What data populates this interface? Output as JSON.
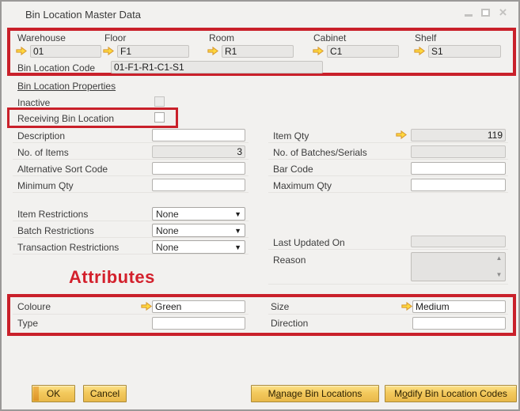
{
  "window": {
    "title": "Bin Location Master Data"
  },
  "location": {
    "segments": [
      {
        "label": "Warehouse",
        "value": "01"
      },
      {
        "label": "Floor",
        "value": "F1"
      },
      {
        "label": "Room",
        "value": "R1"
      },
      {
        "label": "Cabinet",
        "value": "C1"
      },
      {
        "label": "Shelf",
        "value": "S1"
      }
    ],
    "bin_location_code": {
      "label": "Bin Location Code",
      "value": "01-F1-R1-C1-S1"
    }
  },
  "links": {
    "bin_location_properties": "Bin Location Properties"
  },
  "checkboxes": {
    "inactive": {
      "label": "Inactive"
    },
    "receiving": {
      "label": "Receiving Bin Location"
    }
  },
  "fields_left": [
    {
      "label": "Description",
      "value": ""
    },
    {
      "label": "No. of Items",
      "value": "3"
    },
    {
      "label": "Alternative Sort Code",
      "value": ""
    },
    {
      "label": "Minimum Qty",
      "value": ""
    }
  ],
  "fields_right": [
    {
      "label": "Item Qty",
      "value": "119"
    },
    {
      "label": "No. of Batches/Serials",
      "value": ""
    },
    {
      "label": "Bar Code",
      "value": ""
    },
    {
      "label": "Maximum Qty",
      "value": ""
    }
  ],
  "restrictions": [
    {
      "label": "Item Restrictions",
      "value": "None"
    },
    {
      "label": "Batch Restrictions",
      "value": "None"
    },
    {
      "label": "Transaction Restrictions",
      "value": "None"
    }
  ],
  "audit": {
    "last_updated_label": "Last Updated On",
    "last_updated_value": "",
    "reason_label": "Reason",
    "reason_value": ""
  },
  "annotations": {
    "attributes_title": "Attributes"
  },
  "attributes": {
    "coloure": {
      "label": "Coloure",
      "value": "Green"
    },
    "size": {
      "label": "Size",
      "value": "Medium"
    },
    "type": {
      "label": "Type",
      "value": ""
    },
    "direction": {
      "label": "Direction",
      "value": ""
    }
  },
  "buttons": {
    "ok": "OK",
    "cancel": "Cancel",
    "manage": {
      "pre": "M",
      "key": "a",
      "post": "nage Bin Locations"
    },
    "modify": {
      "pre": "M",
      "key": "o",
      "post": "dify Bin Location Codes"
    }
  },
  "colors": {
    "annotation_red": "#c9202a",
    "button_gold": "#f3c95d",
    "arrow_yellow": "#ffd93e"
  }
}
